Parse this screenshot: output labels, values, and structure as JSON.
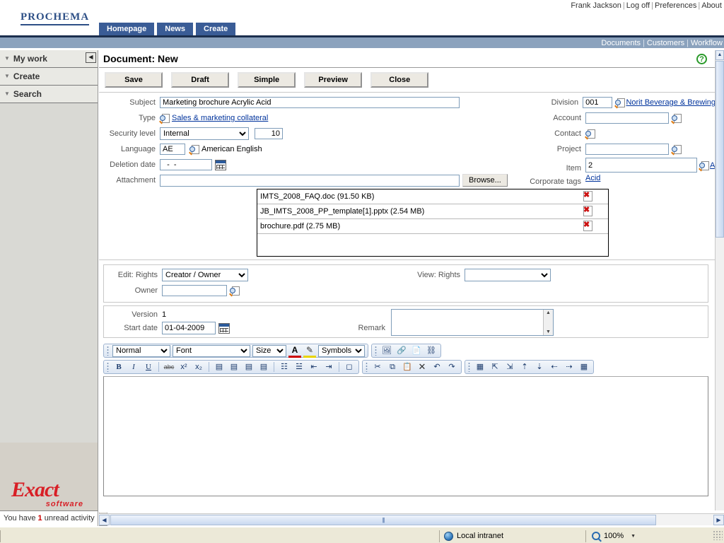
{
  "userbar": {
    "user": "Frank Jackson",
    "links": [
      "Log off",
      "Preferences",
      "About"
    ]
  },
  "brand": {
    "name": "PROCHEMA"
  },
  "nav": {
    "tabs": [
      "Homepage",
      "News",
      "Create"
    ],
    "active": "Homepage"
  },
  "modulebar": {
    "links": [
      "Documents",
      "Customers",
      "Workflow"
    ]
  },
  "sidebar": {
    "items": [
      {
        "label": "My work"
      },
      {
        "label": "Create"
      },
      {
        "label": "Search"
      }
    ],
    "collapse_label": "◀",
    "logo_main": "Exact",
    "logo_sub": "software",
    "unread_prefix": "You have",
    "unread_count": "1",
    "unread_suffix": "unread activity",
    "scroll_btn": "«"
  },
  "page": {
    "title": "Document: New",
    "help_icon": "?",
    "buttons": [
      "Save",
      "Draft",
      "Simple",
      "Preview",
      "Close"
    ]
  },
  "form": {
    "subject": {
      "label": "Subject",
      "value": "Marketing brochure Acrylic Acid"
    },
    "type": {
      "label": "Type",
      "value": "Sales & marketing collateral"
    },
    "security": {
      "label": "Security level",
      "value": "Internal",
      "number": "10"
    },
    "language": {
      "label": "Language",
      "code": "AE",
      "name": "American English"
    },
    "deletion": {
      "label": "Deletion date",
      "value": "  -  -"
    },
    "attachment": {
      "label": "Attachment",
      "browse": "Browse...",
      "path": ""
    },
    "division": {
      "label": "Division",
      "code": "001",
      "name": "Norit Beverage & Brewing"
    },
    "account": {
      "label": "Account",
      "value": ""
    },
    "contact": {
      "label": "Contact",
      "value": ""
    },
    "project": {
      "label": "Project",
      "value": ""
    },
    "item": {
      "label": "Item",
      "value": "2",
      "sub": "Acid",
      "trailing": "A"
    },
    "corporate_tags": {
      "label": "Corporate tags"
    }
  },
  "attachments": [
    {
      "name": "IMTS_2008_FAQ.doc (91.50 KB)"
    },
    {
      "name": "JB_IMTS_2008_PP_template[1].pptx (2.54 MB)"
    },
    {
      "name": "brochure.pdf (2.75 MB)"
    }
  ],
  "rights": {
    "edit_label": "Edit: Rights",
    "edit_value": "Creator / Owner",
    "view_label": "View: Rights",
    "view_value": "",
    "owner_label": "Owner",
    "owner_value": ""
  },
  "version": {
    "version_label": "Version",
    "version_value": "1",
    "start_label": "Start date",
    "start_value": "01-04-2009",
    "remark_label": "Remark",
    "remark_value": ""
  },
  "editor": {
    "style_value": "Normal",
    "font_value": "Font",
    "size_value": "Size",
    "symbols_value": "Symbols",
    "font_color_icon": "A",
    "highlight_icon": "✎",
    "insert_icons": [
      "image-icon",
      "hyperlink-icon",
      "anchor-icon",
      "unlink-icon"
    ],
    "format_icons": [
      "bold",
      "italic",
      "underline",
      "strikethrough",
      "superscript",
      "subscript"
    ],
    "align_icons": [
      "align-left",
      "align-center",
      "align-right",
      "justify"
    ],
    "list_icons": [
      "bullet-list",
      "numbered-list",
      "outdent",
      "indent",
      "clear-format"
    ],
    "clipboard_icons": [
      "cut",
      "copy",
      "paste",
      "delete",
      "undo",
      "redo"
    ],
    "table_icons": [
      "insert-table",
      "insert-row-above",
      "insert-row-below",
      "delete-row",
      "delete-column",
      "insert-col-left",
      "insert-col-right",
      "table-properties"
    ],
    "content": ""
  },
  "statusbar": {
    "zone": "Local intranet",
    "zoom": "100%"
  }
}
